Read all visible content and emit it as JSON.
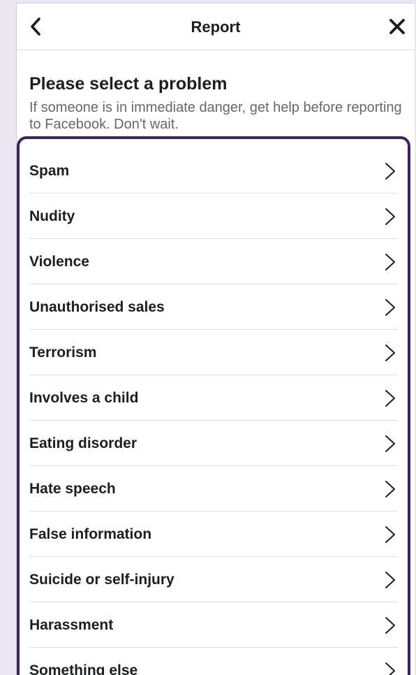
{
  "header": {
    "title": "Report"
  },
  "intro": {
    "title": "Please select a problem",
    "subtitle": "If someone is in immediate danger, get help before reporting to Facebook. Don't wait."
  },
  "problems": [
    {
      "label": "Spam"
    },
    {
      "label": "Nudity"
    },
    {
      "label": "Violence"
    },
    {
      "label": "Unauthorised sales"
    },
    {
      "label": "Terrorism"
    },
    {
      "label": "Involves a child"
    },
    {
      "label": "Eating disorder"
    },
    {
      "label": "Hate speech"
    },
    {
      "label": "False information"
    },
    {
      "label": "Suicide or self-injury"
    },
    {
      "label": "Harassment"
    },
    {
      "label": "Something else"
    }
  ],
  "colors": {
    "background": "#ece6f3",
    "highlight_border": "#3a245f",
    "text": "#1c1e21",
    "subtext": "#65676b"
  },
  "icons": {
    "back": "chevron-left-icon",
    "close": "close-icon",
    "row": "chevron-right-icon"
  }
}
